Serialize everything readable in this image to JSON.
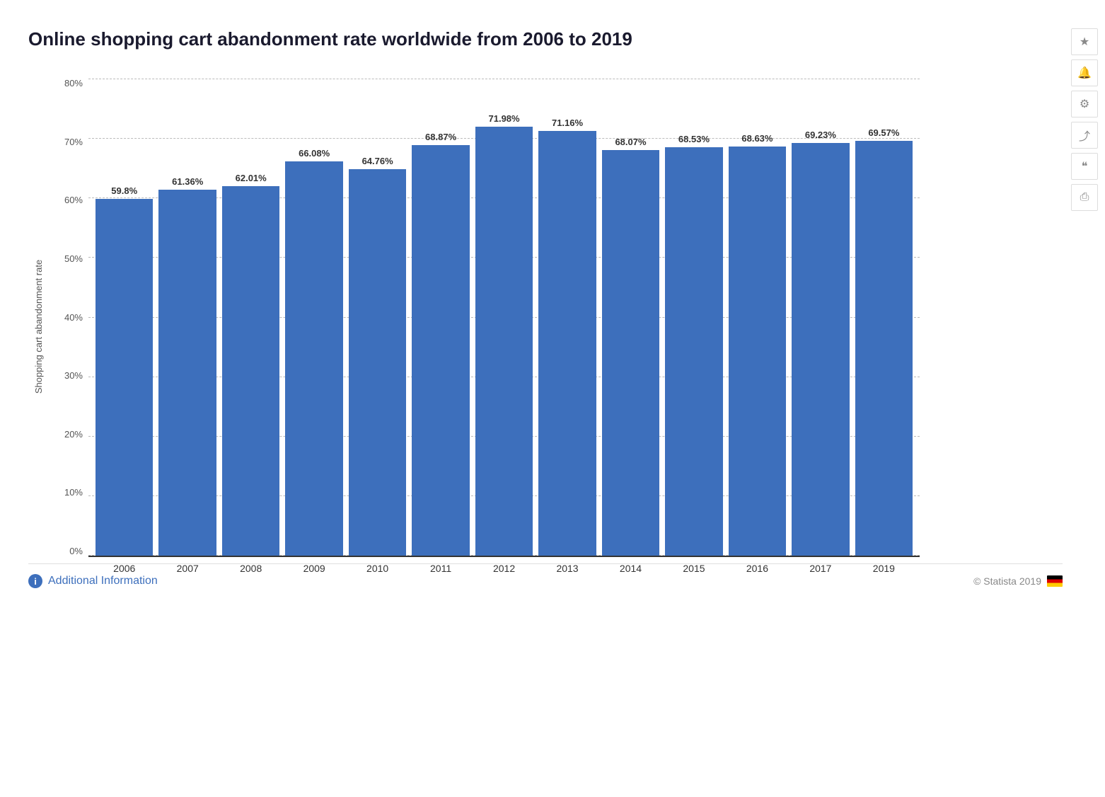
{
  "title": "Online shopping cart abandonment rate worldwide from 2006 to 2019",
  "yAxisLabel": "Shopping cart abandonment rate",
  "yTicks": [
    "0%",
    "10%",
    "20%",
    "30%",
    "40%",
    "50%",
    "60%",
    "70%",
    "80%"
  ],
  "bars": [
    {
      "year": "2006",
      "value": 59.8,
      "label": "59.8%"
    },
    {
      "year": "2007",
      "value": 61.36,
      "label": "61.36%"
    },
    {
      "year": "2008",
      "value": 62.01,
      "label": "62.01%"
    },
    {
      "year": "2009",
      "value": 66.08,
      "label": "66.08%"
    },
    {
      "year": "2010",
      "value": 64.76,
      "label": "64.76%"
    },
    {
      "year": "2011",
      "value": 68.87,
      "label": "68.87%"
    },
    {
      "year": "2012",
      "value": 71.98,
      "label": "71.98%"
    },
    {
      "year": "2013",
      "value": 71.16,
      "label": "71.16%"
    },
    {
      "year": "2014",
      "value": 68.07,
      "label": "68.07%"
    },
    {
      "year": "2015",
      "value": 68.53,
      "label": "68.53%"
    },
    {
      "year": "2016",
      "value": 68.63,
      "label": "68.63%"
    },
    {
      "year": "2017",
      "value": 69.23,
      "label": "69.23%"
    },
    {
      "year": "2019",
      "value": 69.57,
      "label": "69.57%"
    }
  ],
  "sidebarIcons": [
    {
      "name": "star-icon",
      "symbol": "★"
    },
    {
      "name": "bell-icon",
      "symbol": "🔔"
    },
    {
      "name": "gear-icon",
      "symbol": "⚙"
    },
    {
      "name": "share-icon",
      "symbol": "↗"
    },
    {
      "name": "quote-icon",
      "symbol": "❝"
    },
    {
      "name": "print-icon",
      "symbol": "⎙"
    }
  ],
  "footer": {
    "additionalInfo": "Additional Information",
    "copyright": "© Statista 2019"
  },
  "barColor": "#3d6fbc",
  "maxPercent": 80
}
